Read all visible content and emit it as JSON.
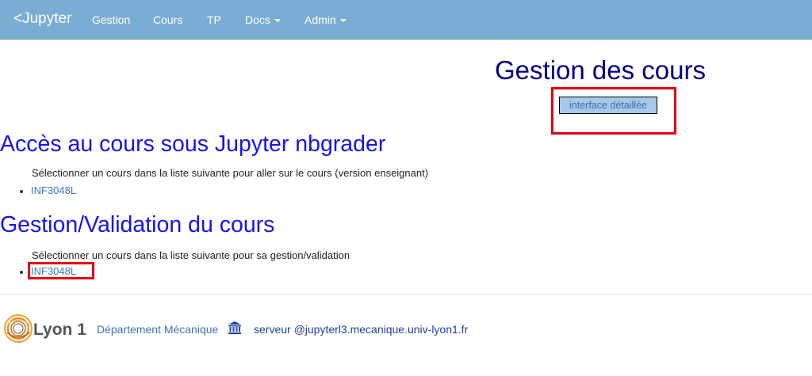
{
  "navbar": {
    "brand": "<Jupyter",
    "items": [
      {
        "label": "Gestion"
      },
      {
        "label": "Cours"
      },
      {
        "label": "TP"
      },
      {
        "label": "Docs"
      },
      {
        "label": "Admin"
      }
    ]
  },
  "header": {
    "title": "Gestion des cours",
    "detail_button": "interface détaillée"
  },
  "sections": [
    {
      "title": "Accès au cours sous Jupyter nbgrader",
      "instruction": "Sélectionner un cours dans la liste suivante pour aller sur le cours (version enseignant)",
      "courses": [
        "INF3048L"
      ]
    },
    {
      "title": "Gestion/Validation du cours",
      "instruction": "Sélectionner un cours dans la liste suivante pour sa gestion/validation",
      "courses": [
        "INF3048L"
      ]
    }
  ],
  "footer": {
    "logo_text": "Lyon 1",
    "department": "Département Mécanique",
    "server": "serveur @jupyterl3.mecanique.univ-lyon1.fr",
    "icons": {
      "logo": "lyon1-logo-icon",
      "institution": "bank-icon"
    }
  },
  "colors": {
    "navbar": "#7aadd4",
    "title": "#000080",
    "section_title": "#1515e8",
    "link": "#3a76b5",
    "highlight": "#e3000f"
  }
}
